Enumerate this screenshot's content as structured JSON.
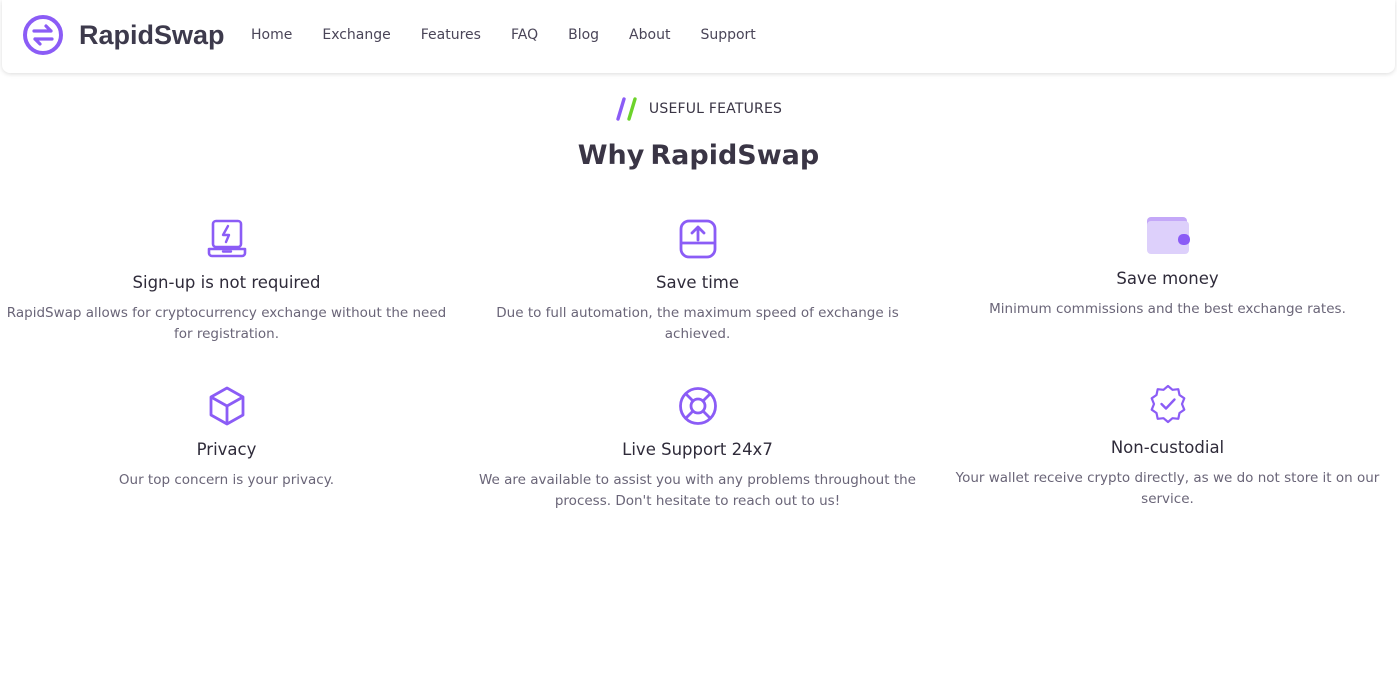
{
  "brand": {
    "name": "RapidSwap",
    "logo_icon": "swap-arrows-icon",
    "accent": "#8b5cf6"
  },
  "nav": {
    "items": [
      {
        "label": "Home"
      },
      {
        "label": "Exchange"
      },
      {
        "label": "Features"
      },
      {
        "label": "FAQ"
      },
      {
        "label": "Blog"
      },
      {
        "label": "About"
      },
      {
        "label": "Support"
      }
    ]
  },
  "section": {
    "eyebrow": "USEFUL FEATURES",
    "eyebrow_colors": [
      "#8b5cf6",
      "#6dd32b"
    ],
    "heading_prefix": "Why",
    "heading_brand": "RapidSwap"
  },
  "features": [
    {
      "icon": "laptop-bolt-icon",
      "title": "Sign-up is not required",
      "description": "RapidSwap allows for cryptocurrency exchange without the need for registration."
    },
    {
      "icon": "upload-box-icon",
      "title": "Save time",
      "description": "Due to full automation, the maximum speed of exchange is achieved."
    },
    {
      "icon": "wallet-icon",
      "title": "Save money",
      "description": "Minimum commissions and the best exchange rates."
    },
    {
      "icon": "cube-icon",
      "title": "Privacy",
      "description": "Our top concern is your privacy."
    },
    {
      "icon": "lifebuoy-icon",
      "title": "Live Support 24x7",
      "description": "We are available to assist you with any problems throughout the process. Don't hesitate to reach out to us!"
    },
    {
      "icon": "verified-badge-icon",
      "title": "Non-custodial",
      "description": "Your wallet receive crypto directly, as we do not store it on our service."
    }
  ]
}
